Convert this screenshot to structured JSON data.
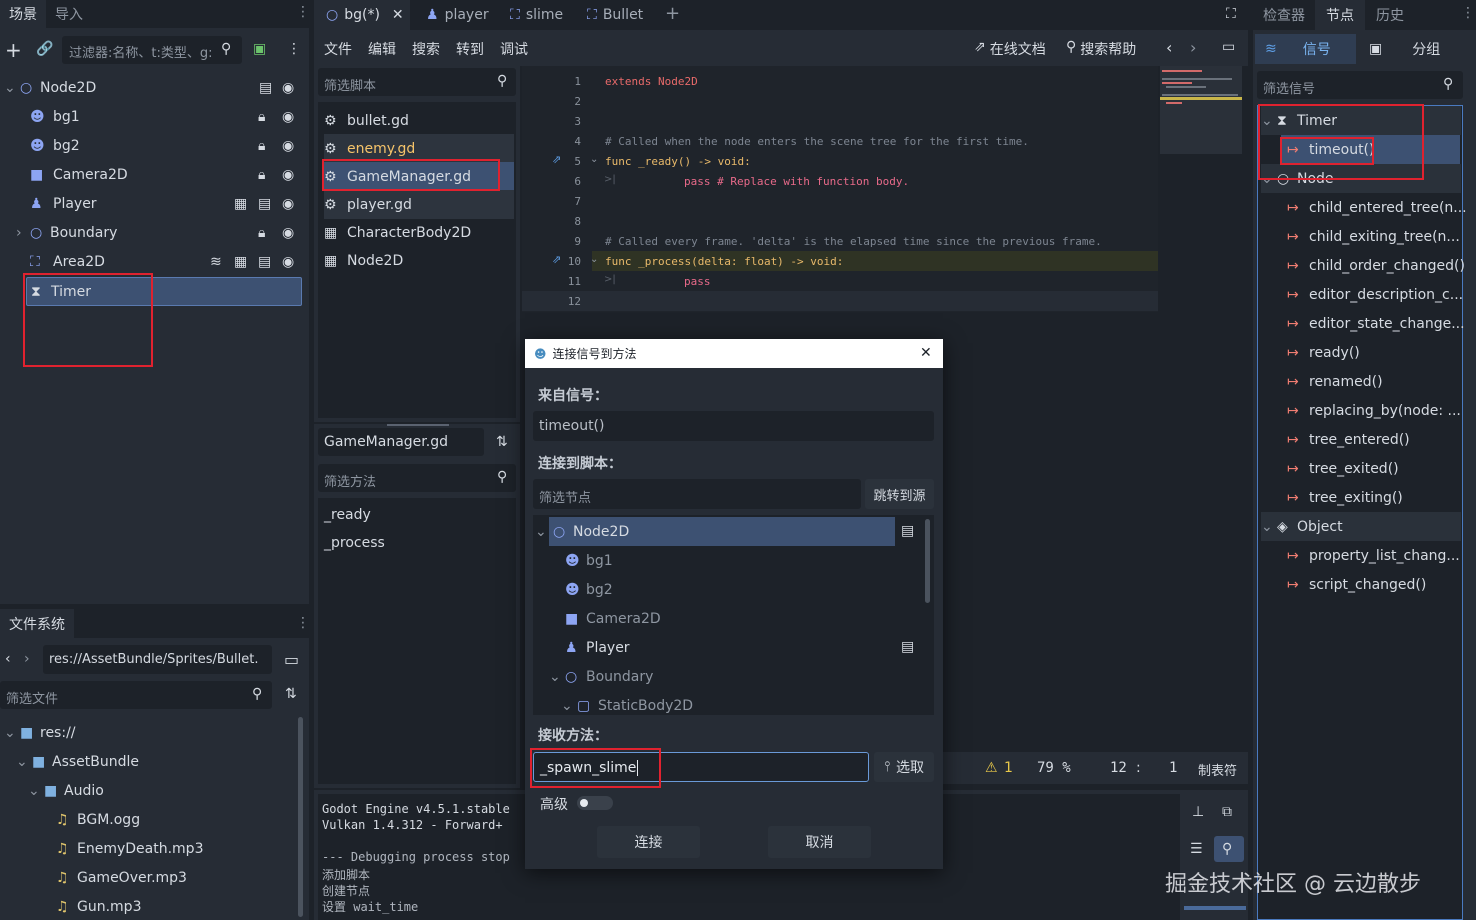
{
  "scene_dock": {
    "tabs": [
      "场景",
      "导入"
    ],
    "filter_placeholder": "过滤器:名称、t:类型、g:",
    "tree": [
      {
        "label": "Node2D"
      },
      {
        "label": "bg1"
      },
      {
        "label": "bg2"
      },
      {
        "label": "Camera2D"
      },
      {
        "label": "Player"
      },
      {
        "label": "Boundary"
      },
      {
        "label": "Area2D"
      },
      {
        "label": "Timer"
      }
    ]
  },
  "filesystem": {
    "title": "文件系统",
    "path": "res://AssetBundle/Sprites/Bullet.",
    "filter_placeholder": "筛选文件",
    "items": [
      "res://",
      "AssetBundle",
      "Audio",
      "BGM.ogg",
      "EnemyDeath.mp3",
      "GameOver.mp3",
      "Gun.mp3"
    ]
  },
  "editor_tabs": [
    "bg(*)",
    "player",
    "slime",
    "Bullet"
  ],
  "menu": [
    "文件",
    "编辑",
    "搜索",
    "转到",
    "调试"
  ],
  "toolbar": {
    "online_docs": "在线文档",
    "search_help": "搜索帮助"
  },
  "script_list": {
    "filter_placeholder": "筛选脚本",
    "items": [
      "bullet.gd",
      "enemy.gd",
      "GameManager.gd",
      "player.gd",
      "CharacterBody2D",
      "Node2D"
    ],
    "current": "GameManager.gd",
    "methods_filter_placeholder": "筛选方法",
    "methods": [
      "_ready",
      "_process"
    ]
  },
  "code": {
    "line_numbers": [
      "1",
      "2",
      "3",
      "4",
      "5",
      "6",
      "7",
      "8",
      "9",
      "10",
      "11",
      "12"
    ],
    "lines": [
      "extends Node2D",
      "",
      "",
      "# Called when the node enters the scene tree for the first time.",
      "func _ready() -> void:",
      "\tpass # Replace with function body.",
      "",
      "",
      "# Called every frame. 'delta' is the elapsed time since the previous frame.",
      "func _process(delta: float) -> void:",
      "\tpass",
      ""
    ]
  },
  "status_bar": {
    "warnings": "1",
    "zoom": "79 %",
    "line": "12",
    "col": "1",
    "indent": "制表符"
  },
  "output": {
    "lines": [
      "Godot Engine v4.5.1.stable",
      "Vulkan 1.4.312 - Forward+",
      "",
      "--- Debugging process stop",
      "添加脚本",
      "创建节点",
      "设置 wait_time"
    ]
  },
  "dialog": {
    "title": "连接信号到方法",
    "from_signal_label": "来自信号：",
    "signal": "timeout()",
    "connect_to_script_label": "连接到脚本：",
    "filter_nodes_placeholder": "筛选节点",
    "jump_to_source": "跳转到源",
    "tree": [
      "Node2D",
      "bg1",
      "bg2",
      "Camera2D",
      "Player",
      "Boundary",
      "StaticBody2D"
    ],
    "receiver_method_label": "接收方法：",
    "method_value": "_spawn_slime",
    "pick": "选取",
    "advanced": "高级",
    "connect": "连接",
    "cancel": "取消"
  },
  "right_dock": {
    "tabs": [
      "检查器",
      "节点",
      "历史"
    ],
    "subtabs": [
      "信号",
      "分组"
    ],
    "filter_placeholder": "筛选信号",
    "sections": [
      {
        "title": "Timer",
        "signals": [
          "timeout()"
        ]
      },
      {
        "title": "Node",
        "signals": [
          "child_entered_tree(n...",
          "child_exiting_tree(n...",
          "child_order_changed()",
          "editor_description_c...",
          "editor_state_change...",
          "ready()",
          "renamed()",
          "replacing_by(node: ...",
          "tree_entered()",
          "tree_exited()",
          "tree_exiting()"
        ]
      },
      {
        "title": "Object",
        "signals": [
          "property_list_chang...",
          "script_changed()"
        ]
      }
    ]
  },
  "watermark": "掘金技术社区 @ 云边散步"
}
